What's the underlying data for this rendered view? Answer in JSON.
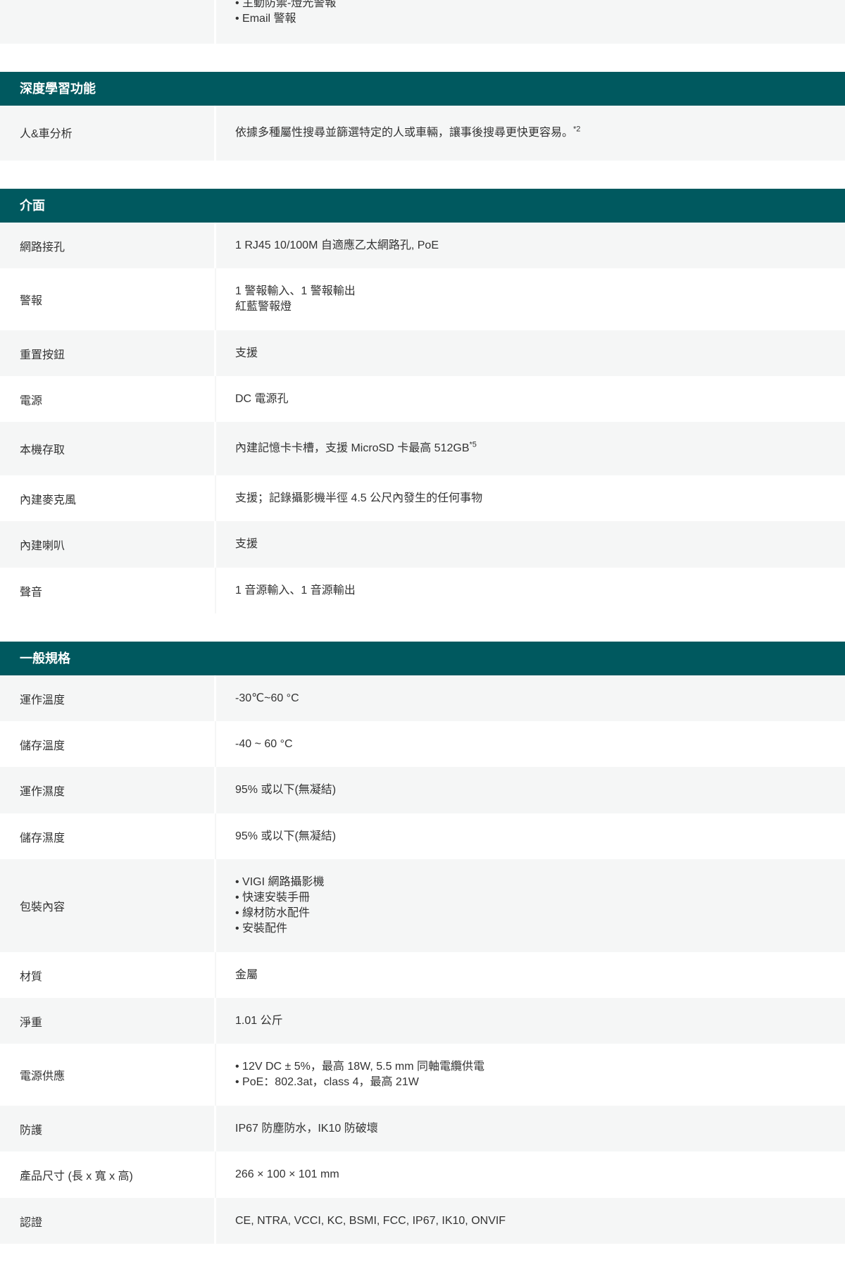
{
  "top_partial": {
    "lines": [
      "主動防禦-燈光警報",
      "Email 警報"
    ]
  },
  "sections": {
    "deep_learning": {
      "title": "深度學習功能",
      "rows": [
        {
          "label": "人&車分析",
          "value": "依據多種屬性搜尋並篩選特定的人或車輛，讓事後搜尋更快更容易。",
          "sup": "*2"
        }
      ]
    },
    "interface": {
      "title": "介面",
      "rows": [
        {
          "label": "網路接孔",
          "value": "1 RJ45 10/100M 自適應乙太網路孔, PoE"
        },
        {
          "label": "警報",
          "lines": [
            "1 警報輸入、1 警報輸出",
            "紅藍警報燈"
          ]
        },
        {
          "label": "重置按鈕",
          "value": "支援"
        },
        {
          "label": "電源",
          "value": "DC 電源孔"
        },
        {
          "label": "本機存取",
          "value": "內建記憶卡卡槽，支援 MicroSD 卡最高 512GB",
          "sup": "*5"
        },
        {
          "label": "內建麥克風",
          "value": "支援；記錄攝影機半徑 4.5 公尺內發生的任何事物"
        },
        {
          "label": "內建喇叭",
          "value": "支援"
        },
        {
          "label": "聲音",
          "value": "1 音源輸入、1 音源輸出"
        }
      ]
    },
    "general": {
      "title": "一般規格",
      "rows": [
        {
          "label": "運作溫度",
          "value": "-30℃~60 °C"
        },
        {
          "label": "儲存溫度",
          "value": "-40 ~ 60 °C"
        },
        {
          "label": "運作濕度",
          "value": "95% 或以下(無凝結)"
        },
        {
          "label": "儲存濕度",
          "value": "95% 或以下(無凝結)"
        },
        {
          "label": "包裝內容",
          "bullets": [
            "VIGI 網路攝影機",
            "快速安裝手冊",
            "線材防水配件",
            "安裝配件"
          ]
        },
        {
          "label": "材質",
          "value": "金屬"
        },
        {
          "label": "淨重",
          "value": "1.01 公斤"
        },
        {
          "label": "電源供應",
          "bullets": [
            "12V DC ± 5%，最高 18W, 5.5 mm 同軸電纜供電",
            "PoE：802.3at，class 4，最高 21W"
          ]
        },
        {
          "label": "防護",
          "value": "IP67 防塵防水，IK10 防破壞"
        },
        {
          "label": "產品尺寸 (長 x 寬 x 高)",
          "value": "266 × 100 × 101 mm"
        },
        {
          "label": "認證",
          "value": "CE, NTRA, VCCI, KC, BSMI, FCC, IP67, IK10, ONVIF"
        }
      ]
    }
  }
}
